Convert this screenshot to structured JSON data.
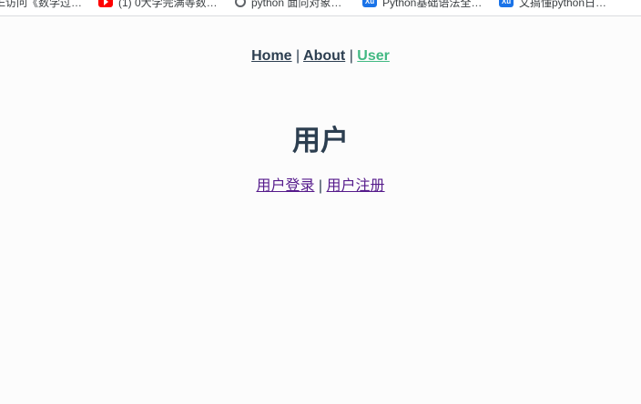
{
  "bookmarks": [
    {
      "label": "E访问《数学过…",
      "icon": "none"
    },
    {
      "label": "(1) 0大学完满等数…",
      "icon": "youtube-icon"
    },
    {
      "label": "python 面向对象…",
      "icon": "search-icon"
    },
    {
      "label": "Python基础语法全…",
      "icon": "xu-icon"
    },
    {
      "label": "文搞懂python日…",
      "icon": "xu-icon"
    }
  ],
  "nav": {
    "home": "Home",
    "about": "About",
    "user": "User",
    "separator": "|"
  },
  "page": {
    "title": "用户"
  },
  "sub_nav": {
    "login": "用户登录",
    "register": "用户注册",
    "separator": "|"
  },
  "colors": {
    "text": "#2c3e50",
    "active_link": "#42b983",
    "visited_link": "#551a8b"
  }
}
